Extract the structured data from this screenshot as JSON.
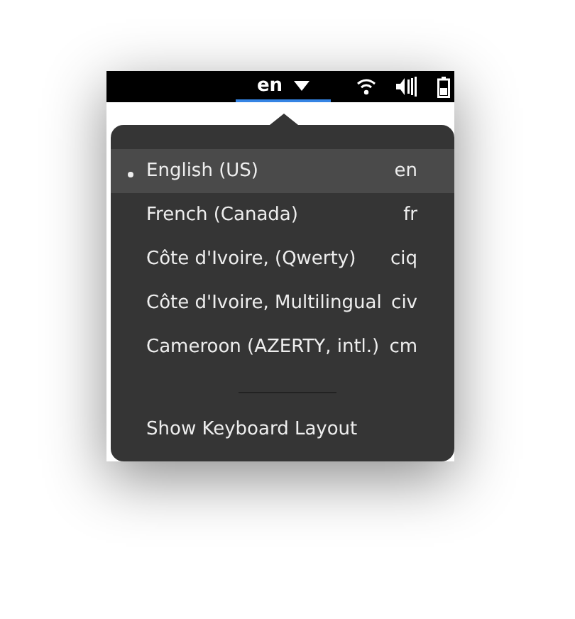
{
  "top_bar": {
    "indicator": "en",
    "indicator_active": true
  },
  "menu": {
    "items": [
      {
        "label": "English (US)",
        "code": "en",
        "selected": true,
        "hovered": true
      },
      {
        "label": "French (Canada)",
        "code": "fr",
        "selected": false,
        "hovered": false
      },
      {
        "label": "Côte d'Ivoire, (Qwerty)",
        "code": "ciq",
        "selected": false,
        "hovered": false
      },
      {
        "label": "Côte d'Ivoire, Multilingual",
        "code": "civ",
        "selected": false,
        "hovered": false
      },
      {
        "label": "Cameroon (AZERTY, intl.)",
        "code": "cm",
        "selected": false,
        "hovered": false
      }
    ],
    "action": "Show Keyboard Layout"
  }
}
